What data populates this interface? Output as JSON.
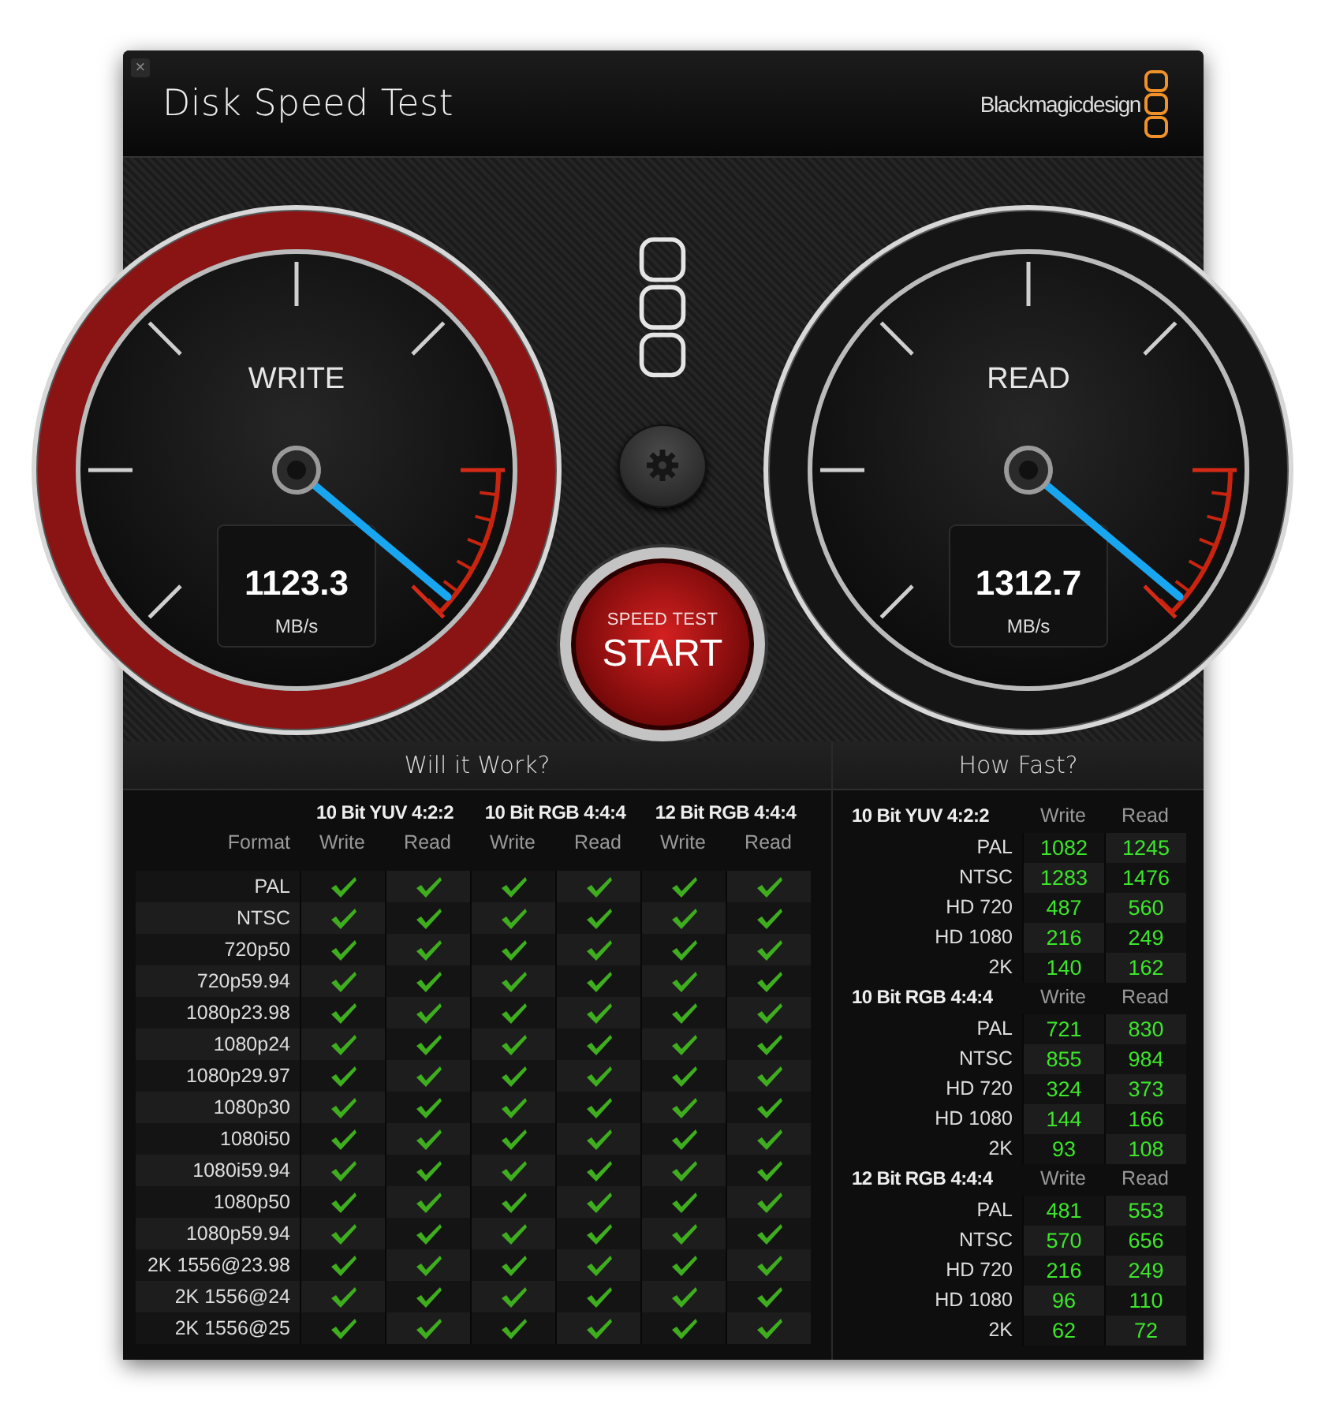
{
  "window": {
    "close": "×",
    "title": "Disk Speed Test",
    "brand": "Blackmagicdesign"
  },
  "gauges": [
    {
      "label": "WRITE",
      "value": "1123.3",
      "unit": "MB/s",
      "color": "#8a1414"
    },
    {
      "label": "READ",
      "value": "1312.7",
      "unit": "MB/s",
      "color": "#151515"
    }
  ],
  "start_button": {
    "caption": "SPEED TEST",
    "label": "START"
  },
  "will_it_work": {
    "title": "Will it Work?",
    "groups": [
      "10 Bit YUV 4:2:2",
      "10 Bit RGB 4:4:4",
      "12 Bit RGB 4:4:4"
    ],
    "format_heading": "Format",
    "columns": [
      "Write",
      "Read",
      "Write",
      "Read",
      "Write",
      "Read"
    ],
    "rows": [
      {
        "format": "PAL",
        "checks": [
          true,
          true,
          true,
          true,
          true,
          true
        ]
      },
      {
        "format": "NTSC",
        "checks": [
          true,
          true,
          true,
          true,
          true,
          true
        ]
      },
      {
        "format": "720p50",
        "checks": [
          true,
          true,
          true,
          true,
          true,
          true
        ]
      },
      {
        "format": "720p59.94",
        "checks": [
          true,
          true,
          true,
          true,
          true,
          true
        ]
      },
      {
        "format": "1080p23.98",
        "checks": [
          true,
          true,
          true,
          true,
          true,
          true
        ]
      },
      {
        "format": "1080p24",
        "checks": [
          true,
          true,
          true,
          true,
          true,
          true
        ]
      },
      {
        "format": "1080p29.97",
        "checks": [
          true,
          true,
          true,
          true,
          true,
          true
        ]
      },
      {
        "format": "1080p30",
        "checks": [
          true,
          true,
          true,
          true,
          true,
          true
        ]
      },
      {
        "format": "1080i50",
        "checks": [
          true,
          true,
          true,
          true,
          true,
          true
        ]
      },
      {
        "format": "1080i59.94",
        "checks": [
          true,
          true,
          true,
          true,
          true,
          true
        ]
      },
      {
        "format": "1080p50",
        "checks": [
          true,
          true,
          true,
          true,
          true,
          true
        ]
      },
      {
        "format": "1080p59.94",
        "checks": [
          true,
          true,
          true,
          true,
          true,
          true
        ]
      },
      {
        "format": "2K 1556@23.98",
        "checks": [
          true,
          true,
          true,
          true,
          true,
          true
        ]
      },
      {
        "format": "2K 1556@24",
        "checks": [
          true,
          true,
          true,
          true,
          true,
          true
        ]
      },
      {
        "format": "2K 1556@25",
        "checks": [
          true,
          true,
          true,
          true,
          true,
          true
        ]
      }
    ]
  },
  "how_fast": {
    "title": "How Fast?",
    "groups": [
      {
        "name": "10 Bit YUV 4:2:2",
        "write_heading": "Write",
        "read_heading": "Read",
        "rows": [
          {
            "format": "PAL",
            "write": "1082",
            "read": "1245"
          },
          {
            "format": "NTSC",
            "write": "1283",
            "read": "1476"
          },
          {
            "format": "HD 720",
            "write": "487",
            "read": "560"
          },
          {
            "format": "HD 1080",
            "write": "216",
            "read": "249"
          },
          {
            "format": "2K",
            "write": "140",
            "read": "162"
          }
        ]
      },
      {
        "name": "10 Bit RGB 4:4:4",
        "write_heading": "Write",
        "read_heading": "Read",
        "rows": [
          {
            "format": "PAL",
            "write": "721",
            "read": "830"
          },
          {
            "format": "NTSC",
            "write": "855",
            "read": "984"
          },
          {
            "format": "HD 720",
            "write": "324",
            "read": "373"
          },
          {
            "format": "HD 1080",
            "write": "144",
            "read": "166"
          },
          {
            "format": "2K",
            "write": "93",
            "read": "108"
          }
        ]
      },
      {
        "name": "12 Bit RGB 4:4:4",
        "write_heading": "Write",
        "read_heading": "Read",
        "rows": [
          {
            "format": "PAL",
            "write": "481",
            "read": "553"
          },
          {
            "format": "NTSC",
            "write": "570",
            "read": "656"
          },
          {
            "format": "HD 720",
            "write": "216",
            "read": "249"
          },
          {
            "format": "HD 1080",
            "write": "96",
            "read": "110"
          },
          {
            "format": "2K",
            "write": "62",
            "read": "72"
          }
        ]
      }
    ]
  }
}
